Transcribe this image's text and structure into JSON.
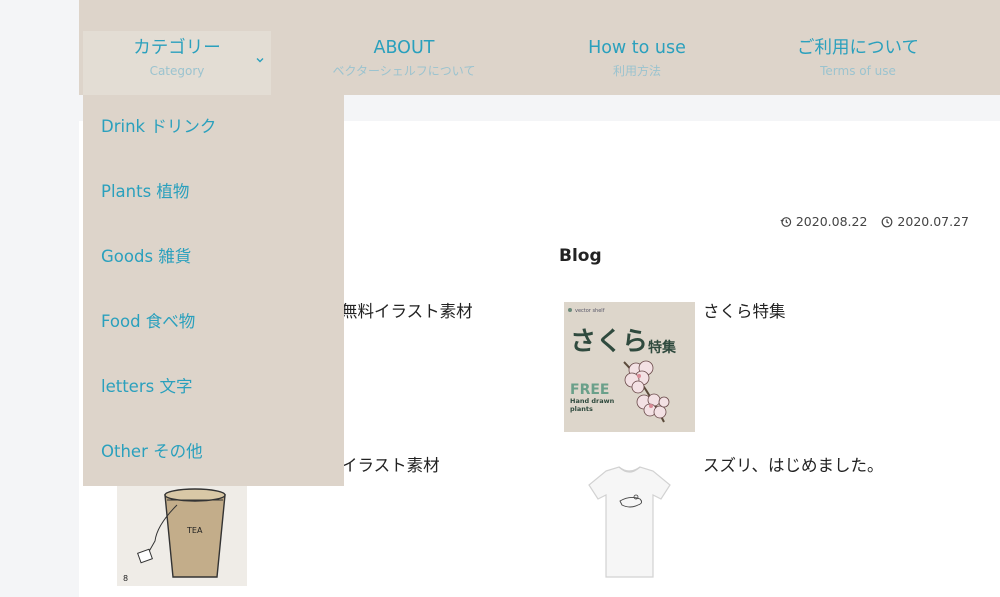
{
  "nav": {
    "items": [
      {
        "main": "カテゴリー",
        "sub": "Category"
      },
      {
        "main": "ABOUT",
        "sub": "ベクターシェルフについて"
      },
      {
        "main": "How to use",
        "sub": "利用方法"
      },
      {
        "main": "ご利用について",
        "sub": "Terms of use"
      }
    ]
  },
  "dropdown": {
    "items": [
      "Drink ドリンク",
      "Plants 植物",
      "Goods 雑貨",
      "Food 食べ物",
      "letters 文字",
      "Other その他"
    ]
  },
  "post": {
    "updated": "2020.08.22",
    "published": "2020.07.27"
  },
  "blog": {
    "heading": "Blog"
  },
  "cards": {
    "left_top_title": "無料イラスト素材",
    "left_bottom_title": "イラスト素材",
    "right_top_title": "さくら特集",
    "right_bottom_title": "スズリ、はじめました。"
  },
  "thumb_sakura": {
    "brand": "vector shelf",
    "title_main": "さくら",
    "title_sub": "特集",
    "free": "FREE",
    "line1": "Hand drawn",
    "line2": "plants"
  },
  "thumb_tea": {
    "cup_label": "TEA"
  },
  "colors": {
    "accent": "#2aa0bd",
    "nav_bg": "#ddd4ca",
    "page_bg": "#f4f5f7"
  }
}
